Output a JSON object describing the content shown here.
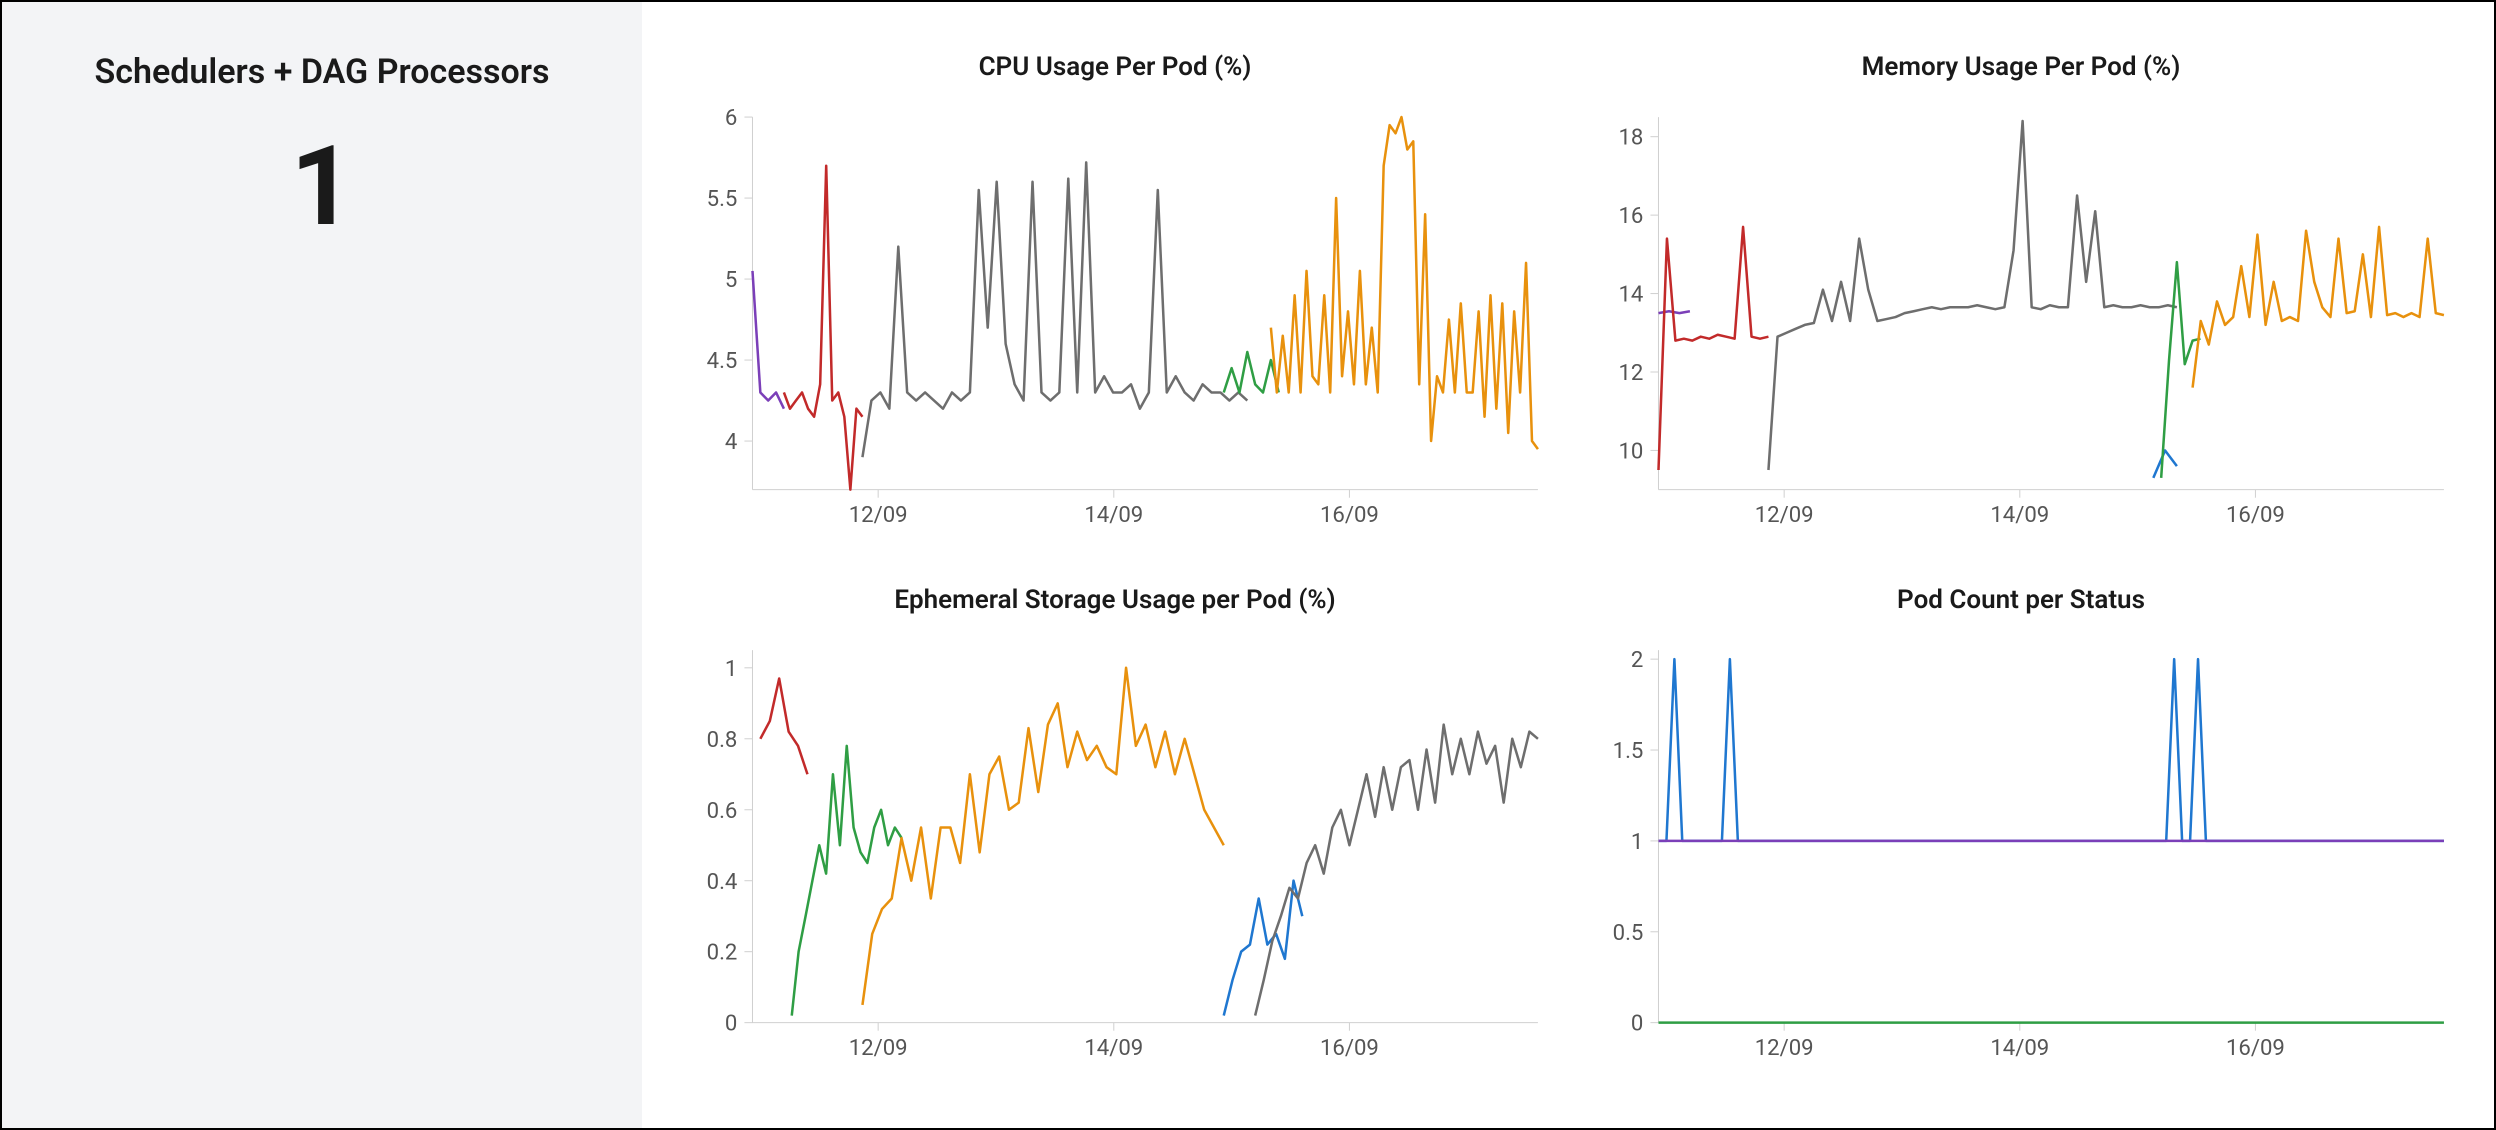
{
  "sidebar": {
    "title": "Schedulers + DAG Processors",
    "value": "1"
  },
  "colors": {
    "purple": "#7b3fb8",
    "red": "#c22a2a",
    "gray": "#6e6e6e",
    "green": "#2f9e44",
    "orange": "#e8910d",
    "blue": "#1f77d0"
  },
  "x_categories": [
    "12/09",
    "14/09",
    "16/09"
  ],
  "chart_data": [
    {
      "id": "cpu",
      "type": "line",
      "title": "CPU Usage Per Pod (%)",
      "xlabel": "",
      "ylabel": "",
      "ylim": [
        3.7,
        6
      ],
      "y_ticks": [
        4,
        4.5,
        5,
        5.5,
        6
      ],
      "x_ticks": [
        "12/09",
        "14/09",
        "16/09"
      ],
      "series": [
        {
          "name": "purple",
          "color": "purple",
          "t_range": [
            0,
            0.04
          ],
          "y": [
            5.05,
            4.3,
            4.25,
            4.3,
            4.2
          ]
        },
        {
          "name": "red",
          "color": "red",
          "t_range": [
            0.04,
            0.14
          ],
          "y": [
            4.3,
            4.2,
            4.25,
            4.3,
            4.2,
            4.15,
            4.35,
            5.7,
            4.25,
            4.3,
            4.15,
            3.7,
            4.2,
            4.15
          ]
        },
        {
          "name": "gray",
          "color": "gray",
          "t_range": [
            0.14,
            0.63
          ],
          "y": [
            3.9,
            4.25,
            4.3,
            4.2,
            5.2,
            4.3,
            4.25,
            4.3,
            4.25,
            4.2,
            4.3,
            4.25,
            4.3,
            5.55,
            4.7,
            5.6,
            4.6,
            4.35,
            4.25,
            5.6,
            4.3,
            4.25,
            4.3,
            5.62,
            4.3,
            5.72,
            4.3,
            4.4,
            4.3,
            4.3,
            4.35,
            4.2,
            4.3,
            5.55,
            4.3,
            4.4,
            4.3,
            4.25,
            4.35,
            4.3,
            4.3,
            4.25,
            4.3,
            4.25
          ]
        },
        {
          "name": "green",
          "color": "green",
          "t_range": [
            0.6,
            0.67
          ],
          "y": [
            4.3,
            4.45,
            4.3,
            4.55,
            4.35,
            4.3,
            4.5,
            4.3
          ]
        },
        {
          "name": "orange",
          "color": "orange",
          "t_range": [
            0.66,
            1.0
          ],
          "y": [
            4.7,
            4.3,
            4.65,
            4.3,
            4.9,
            4.3,
            5.05,
            4.4,
            4.35,
            4.9,
            4.3,
            5.5,
            4.4,
            4.8,
            4.35,
            5.05,
            4.35,
            4.7,
            4.3,
            5.7,
            5.95,
            5.9,
            6.0,
            5.8,
            5.85,
            4.35,
            5.4,
            4.0,
            4.4,
            4.3,
            4.75,
            4.3,
            4.85,
            4.3,
            4.3,
            4.8,
            4.15,
            4.9,
            4.2,
            4.85,
            4.05,
            4.8,
            4.3,
            5.1,
            4.0,
            3.95
          ]
        }
      ]
    },
    {
      "id": "mem",
      "type": "line",
      "title": "Memory Usage Per Pod (%)",
      "xlabel": "",
      "ylabel": "",
      "ylim": [
        9,
        18.5
      ],
      "y_ticks": [
        10,
        12,
        14,
        16,
        18
      ],
      "x_ticks": [
        "12/09",
        "14/09",
        "16/09"
      ],
      "series": [
        {
          "name": "purple",
          "color": "purple",
          "t_range": [
            0,
            0.04
          ],
          "y": [
            13.5,
            13.55,
            13.5,
            13.55
          ]
        },
        {
          "name": "red",
          "color": "red",
          "t_range": [
            0.0,
            0.14
          ],
          "y": [
            9.5,
            15.4,
            12.8,
            12.85,
            12.8,
            12.9,
            12.85,
            12.95,
            12.9,
            12.85,
            15.7,
            12.9,
            12.85,
            12.9
          ]
        },
        {
          "name": "gray",
          "color": "gray",
          "t_range": [
            0.14,
            0.66
          ],
          "y": [
            9.5,
            12.9,
            13.0,
            13.1,
            13.2,
            13.25,
            14.1,
            13.3,
            14.3,
            13.3,
            15.4,
            14.1,
            13.3,
            13.35,
            13.4,
            13.5,
            13.55,
            13.6,
            13.65,
            13.6,
            13.65,
            13.65,
            13.65,
            13.7,
            13.65,
            13.6,
            13.65,
            15.1,
            18.4,
            13.65,
            13.6,
            13.7,
            13.65,
            13.65,
            16.5,
            14.3,
            16.1,
            13.65,
            13.7,
            13.65,
            13.65,
            13.7,
            13.65,
            13.65,
            13.7,
            13.65
          ]
        },
        {
          "name": "blue",
          "color": "blue",
          "t_range": [
            0.63,
            0.66
          ],
          "y": [
            9.3,
            10.0,
            9.6
          ]
        },
        {
          "name": "green",
          "color": "green",
          "t_range": [
            0.64,
            0.69
          ],
          "y": [
            9.3,
            12.3,
            14.8,
            12.2,
            12.8,
            12.85
          ]
        },
        {
          "name": "orange",
          "color": "orange",
          "t_range": [
            0.68,
            1.0
          ],
          "y": [
            11.6,
            13.3,
            12.7,
            13.8,
            13.2,
            13.4,
            14.7,
            13.4,
            15.5,
            13.2,
            14.3,
            13.3,
            13.4,
            13.3,
            15.6,
            14.3,
            13.65,
            13.4,
            15.4,
            13.5,
            13.55,
            15.0,
            13.4,
            15.7,
            13.45,
            13.5,
            13.4,
            13.5,
            13.4,
            15.4,
            13.5,
            13.45
          ]
        }
      ]
    },
    {
      "id": "storage",
      "type": "line",
      "title": "Ephemeral Storage Usage per Pod (%)",
      "xlabel": "",
      "ylabel": "",
      "ylim": [
        0,
        1.05
      ],
      "y_ticks": [
        0,
        0.2,
        0.4,
        0.6,
        0.8,
        1
      ],
      "x_ticks": [
        "12/09",
        "14/09",
        "16/09"
      ],
      "series": [
        {
          "name": "red",
          "color": "red",
          "t_range": [
            0.01,
            0.07
          ],
          "y": [
            0.8,
            0.85,
            0.97,
            0.82,
            0.78,
            0.7
          ]
        },
        {
          "name": "green",
          "color": "green",
          "t_range": [
            0.05,
            0.19
          ],
          "y": [
            0.02,
            0.2,
            0.3,
            0.4,
            0.5,
            0.42,
            0.7,
            0.5,
            0.78,
            0.55,
            0.48,
            0.45,
            0.55,
            0.6,
            0.5,
            0.55,
            0.52
          ]
        },
        {
          "name": "orange",
          "color": "orange",
          "t_range": [
            0.14,
            0.6
          ],
          "y": [
            0.05,
            0.25,
            0.32,
            0.35,
            0.52,
            0.4,
            0.55,
            0.35,
            0.55,
            0.55,
            0.45,
            0.7,
            0.48,
            0.7,
            0.75,
            0.6,
            0.62,
            0.83,
            0.65,
            0.84,
            0.9,
            0.72,
            0.82,
            0.74,
            0.78,
            0.72,
            0.7,
            1.0,
            0.78,
            0.84,
            0.72,
            0.82,
            0.7,
            0.8,
            0.7,
            0.6,
            0.55,
            0.5
          ]
        },
        {
          "name": "blue",
          "color": "blue",
          "t_range": [
            0.6,
            0.7
          ],
          "y": [
            0.02,
            0.12,
            0.2,
            0.22,
            0.35,
            0.22,
            0.25,
            0.18,
            0.4,
            0.3
          ]
        },
        {
          "name": "gray",
          "color": "gray",
          "t_range": [
            0.64,
            1.0
          ],
          "y": [
            0.02,
            0.12,
            0.23,
            0.3,
            0.38,
            0.35,
            0.45,
            0.5,
            0.42,
            0.55,
            0.6,
            0.5,
            0.6,
            0.7,
            0.58,
            0.72,
            0.6,
            0.72,
            0.74,
            0.6,
            0.77,
            0.62,
            0.84,
            0.7,
            0.8,
            0.7,
            0.82,
            0.73,
            0.78,
            0.62,
            0.8,
            0.72,
            0.82,
            0.8
          ]
        }
      ]
    },
    {
      "id": "podcount",
      "type": "line",
      "title": "Pod Count per Status",
      "xlabel": "",
      "ylabel": "",
      "ylim": [
        0,
        2.05
      ],
      "y_ticks": [
        0,
        0.5,
        1,
        1.5,
        2
      ],
      "x_ticks": [
        "12/09",
        "14/09",
        "16/09"
      ],
      "series": [
        {
          "name": "green",
          "color": "green",
          "t_range": [
            0,
            1.0
          ],
          "y": [
            0,
            0,
            0,
            0,
            0,
            0,
            0,
            0,
            0,
            0,
            0,
            0,
            0,
            0,
            0,
            0,
            0,
            0,
            0,
            0,
            0,
            0,
            0,
            0,
            0,
            0,
            0,
            0,
            0,
            0,
            0,
            0
          ]
        },
        {
          "name": "blue",
          "color": "blue",
          "t_range": [
            0,
            1.0
          ],
          "y": [
            1,
            1,
            2,
            1,
            1,
            1,
            1,
            1,
            1,
            2,
            1,
            1,
            1,
            1,
            1,
            1,
            1,
            1,
            1,
            1,
            1,
            1,
            1,
            1,
            1,
            1,
            1,
            1,
            1,
            1,
            1,
            1,
            1,
            1,
            1,
            1,
            1,
            1,
            1,
            1,
            1,
            1,
            1,
            1,
            1,
            1,
            1,
            1,
            1,
            1,
            1,
            1,
            1,
            1,
            1,
            1,
            1,
            1,
            1,
            1,
            1,
            1,
            1,
            1,
            1,
            2,
            1,
            1,
            2,
            1,
            1,
            1,
            1,
            1,
            1,
            1,
            1,
            1,
            1,
            1,
            1,
            1,
            1,
            1,
            1,
            1,
            1,
            1,
            1,
            1,
            1,
            1,
            1,
            1,
            1,
            1,
            1,
            1,
            1,
            1
          ]
        },
        {
          "name": "purple",
          "color": "purple",
          "t_range": [
            0,
            1.0
          ],
          "y": [
            1,
            1,
            1,
            1,
            1,
            1,
            1,
            1,
            1,
            1,
            1,
            1,
            1,
            1,
            1,
            1,
            1,
            1,
            1,
            1,
            1,
            1,
            1,
            1,
            1,
            1,
            1,
            1,
            1,
            1,
            1,
            1
          ]
        }
      ]
    }
  ]
}
